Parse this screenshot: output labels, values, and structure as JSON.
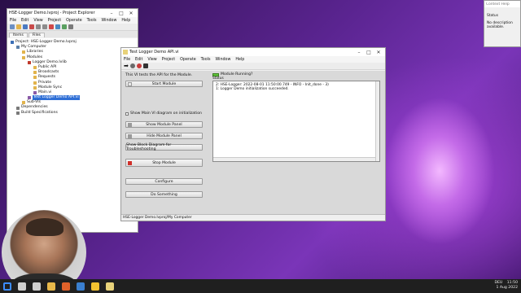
{
  "project_explorer": {
    "title": "HSE-Logger Demo.lvproj - Project Explorer",
    "menu": [
      "File",
      "Edit",
      "View",
      "Project",
      "Operate",
      "Tools",
      "Window",
      "Help"
    ],
    "tabs": [
      "Items",
      "Files"
    ],
    "tree": [
      {
        "label": "Project: HSE-Logger Demo.lvproj",
        "level": 0,
        "icon": "project-icon",
        "color": "#3b6fb6"
      },
      {
        "label": "My Computer",
        "level": 1,
        "icon": "computer-icon",
        "color": "#5a7fa8"
      },
      {
        "label": "Libraries",
        "level": 2,
        "icon": "folder-icon",
        "color": "#e2b44c"
      },
      {
        "label": "Modules",
        "level": 2,
        "icon": "folder-icon",
        "color": "#e2b44c"
      },
      {
        "label": "Logger Demo.lvlib",
        "level": 3,
        "icon": "library-icon",
        "color": "#c0392b"
      },
      {
        "label": "Public API",
        "level": 4,
        "icon": "folder-icon",
        "color": "#e2b44c"
      },
      {
        "label": "Broadcasts",
        "level": 4,
        "icon": "folder-icon",
        "color": "#e2b44c"
      },
      {
        "label": "Requests",
        "level": 4,
        "icon": "folder-icon",
        "color": "#e2b44c"
      },
      {
        "label": "Private",
        "level": 4,
        "icon": "folder-icon",
        "color": "#e2b44c"
      },
      {
        "label": "Module Sync",
        "level": 4,
        "icon": "folder-icon",
        "color": "#e2b44c"
      },
      {
        "label": "Main.vi",
        "level": 4,
        "icon": "vi-icon",
        "color": "#8a5aa8"
      },
      {
        "label": "Test Logger Demo API.vi",
        "level": 3,
        "icon": "vi-icon",
        "color": "#8a5aa8",
        "selected": true
      },
      {
        "label": "Sub-VIs",
        "level": 2,
        "icon": "folder-icon",
        "color": "#e2b44c"
      },
      {
        "label": "Dependencies",
        "level": 1,
        "icon": "dependencies-icon",
        "color": "#7a7a7a"
      },
      {
        "label": "Build Specifications",
        "level": 1,
        "icon": "build-icon",
        "color": "#7a7a7a"
      }
    ]
  },
  "vi_window": {
    "title": "Test Logger Demo API.vi",
    "menu": [
      "File",
      "Edit",
      "View",
      "Project",
      "Operate",
      "Tools",
      "Window",
      "Help"
    ],
    "hint": "This VI tests the API for the Module.",
    "buttons": {
      "start": "Start Module",
      "show_main_diagram": "Show Main VI diagram on initialization",
      "show_panel": "Show Module Panel",
      "hide_panel": "Hide Module Panel",
      "show_block_diagram": "Show Block Diagram for Troubleshooting",
      "stop": "Stop Module",
      "configure": "Configure",
      "do_something": "Do Something"
    },
    "module_running_label": "Module Running?",
    "status_label": "Status",
    "log_lines": [
      "2: HSE-Logger: 2022-08-01 11:50:00.749 - INFO - Init_done - 3)",
      "1: Logger Demo initialization succeeded."
    ],
    "statusbar": "HSE-Logger Demo.lvproj/My Computer"
  },
  "context_help": {
    "title": "Context Help",
    "heading": "Status",
    "body": "No description available."
  },
  "taskbar": {
    "time": "11:50",
    "date": "1 Aug 2022",
    "language": "DEU",
    "apps": [
      "start-icon",
      "search-icon",
      "task-view-icon",
      "explorer-icon",
      "firefox-icon",
      "mail-icon",
      "labview-icon",
      "vi-icon"
    ],
    "app_colors": [
      "#3c8cff",
      "#cfcfcf",
      "#cfcfcf",
      "#e8b84a",
      "#e0612a",
      "#3a7fd0",
      "#f2c230",
      "#e8d27a"
    ]
  }
}
